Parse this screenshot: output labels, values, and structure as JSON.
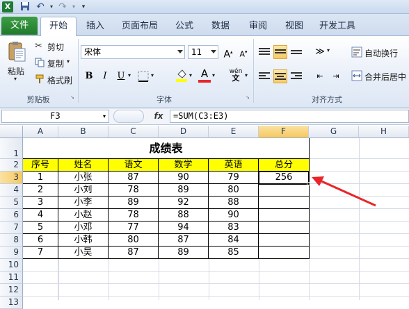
{
  "app": {
    "icon": "excel-icon"
  },
  "quick_access": [
    "save-icon",
    "undo-icon",
    "redo-icon",
    "customize-icon"
  ],
  "tabs": [
    "文件",
    "开始",
    "插入",
    "页面布局",
    "公式",
    "数据",
    "审阅",
    "视图",
    "开发工具"
  ],
  "ribbon": {
    "clipboard": {
      "paste": "粘贴",
      "cut": "剪切",
      "copy": "复制",
      "format_painter": "格式刷",
      "label": "剪贴板"
    },
    "font": {
      "name": "宋体",
      "size": "11",
      "bold": "B",
      "italic": "I",
      "underline": "U",
      "label": "字体",
      "phonetic": "wén"
    },
    "alignment": {
      "wrap": "自动换行",
      "merge": "合并后居中",
      "label": "对齐方式"
    }
  },
  "formula_bar": {
    "name_box": "F3",
    "fx": "fx",
    "formula": "=SUM(C3:E3)"
  },
  "columns": [
    "A",
    "B",
    "C",
    "D",
    "E",
    "F",
    "G",
    "H"
  ],
  "rows": [
    "1",
    "2",
    "3",
    "4",
    "5",
    "6",
    "7",
    "8",
    "9",
    "10",
    "11",
    "12",
    "13"
  ],
  "selected_cell": "F3",
  "sheet": {
    "title": "成绩表",
    "headers": [
      "序号",
      "姓名",
      "语文",
      "数学",
      "英语",
      "总分"
    ],
    "data": [
      [
        "1",
        "小张",
        "87",
        "90",
        "79",
        "256"
      ],
      [
        "2",
        "小刘",
        "78",
        "89",
        "80",
        ""
      ],
      [
        "3",
        "小李",
        "89",
        "92",
        "88",
        ""
      ],
      [
        "4",
        "小赵",
        "78",
        "88",
        "90",
        ""
      ],
      [
        "5",
        "小邓",
        "77",
        "94",
        "83",
        ""
      ],
      [
        "6",
        "小韩",
        "80",
        "87",
        "84",
        ""
      ],
      [
        "7",
        "小吴",
        "87",
        "89",
        "85",
        ""
      ]
    ]
  },
  "colors": {
    "header_fill": "#ffff00",
    "arrow": "#e8262a",
    "selection": "#000000"
  }
}
